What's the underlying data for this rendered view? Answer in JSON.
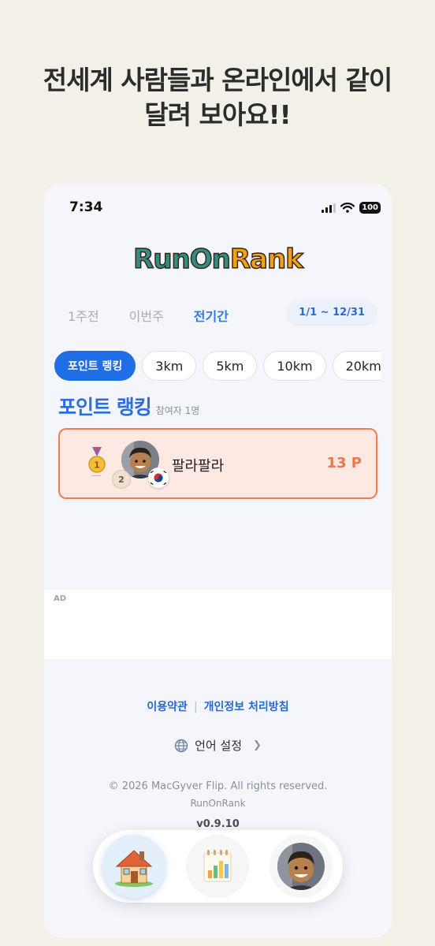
{
  "headline": {
    "line1": "전세계 사람들과 온라인에서 같이",
    "line2": "달려 보아요!!"
  },
  "status_bar": {
    "time": "7:34",
    "battery": "100"
  },
  "logo": {
    "part1": "RunOn",
    "part2": "Rank"
  },
  "period_tabs": [
    "1주전",
    "이번주",
    "전기간"
  ],
  "date_range": "1/1 ~ 12/31",
  "category_chips": [
    "포인트 랭킹",
    "3km",
    "5km",
    "10km",
    "20km"
  ],
  "ranking": {
    "title": "포인트 랭킹",
    "participants": "참여자 1명",
    "entries": [
      {
        "rank": "1",
        "level": "2",
        "name": "팔라팔라",
        "points": "13 P"
      }
    ]
  },
  "ad": {
    "label": "AD"
  },
  "footer": {
    "terms": "이용약관",
    "separator": "|",
    "privacy": "개인정보 처리방침",
    "language": "언어 설정",
    "copyright": "© 2026 MacGyver Flip. All rights reserved.",
    "app_name": "RunOnRank",
    "version": "v0.9.10"
  },
  "colors": {
    "accent": "#1f6ee6",
    "points": "#e9774c",
    "card_bg": "#fde9e1",
    "card_border": "#ef7f51"
  },
  "icons": {
    "home": "house-icon",
    "stats": "chart-icon",
    "profile": "avatar-icon"
  }
}
